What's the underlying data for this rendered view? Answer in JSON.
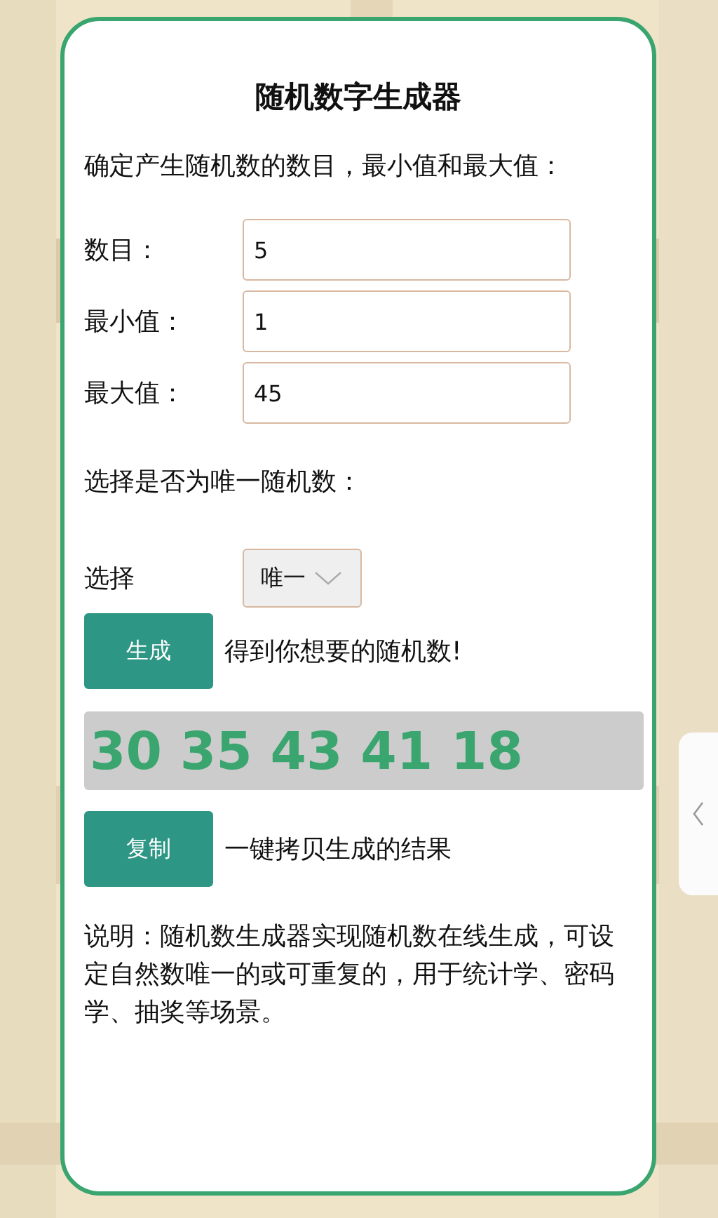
{
  "title": "随机数字生成器",
  "intro": "确定产生随机数的数目，最小值和最大值：",
  "fields": [
    {
      "label": "数目：",
      "value": "5"
    },
    {
      "label": "最小值：",
      "value": "1"
    },
    {
      "label": "最大值：",
      "value": "45"
    }
  ],
  "unique_prompt": "选择是否为唯一随机数：",
  "select": {
    "label": "选择",
    "value": "唯一"
  },
  "generate": {
    "button": "生成",
    "hint": "得到你想要的随机数!"
  },
  "result": "30 35 43 41 18",
  "copy": {
    "button": "复制",
    "hint": "一键拷贝生成的结果"
  },
  "description": "说明：随机数生成器实现随机数在线生成，可设定自然数唯一的或可重复的，用于统计学、密码学、抽奖等场景。"
}
